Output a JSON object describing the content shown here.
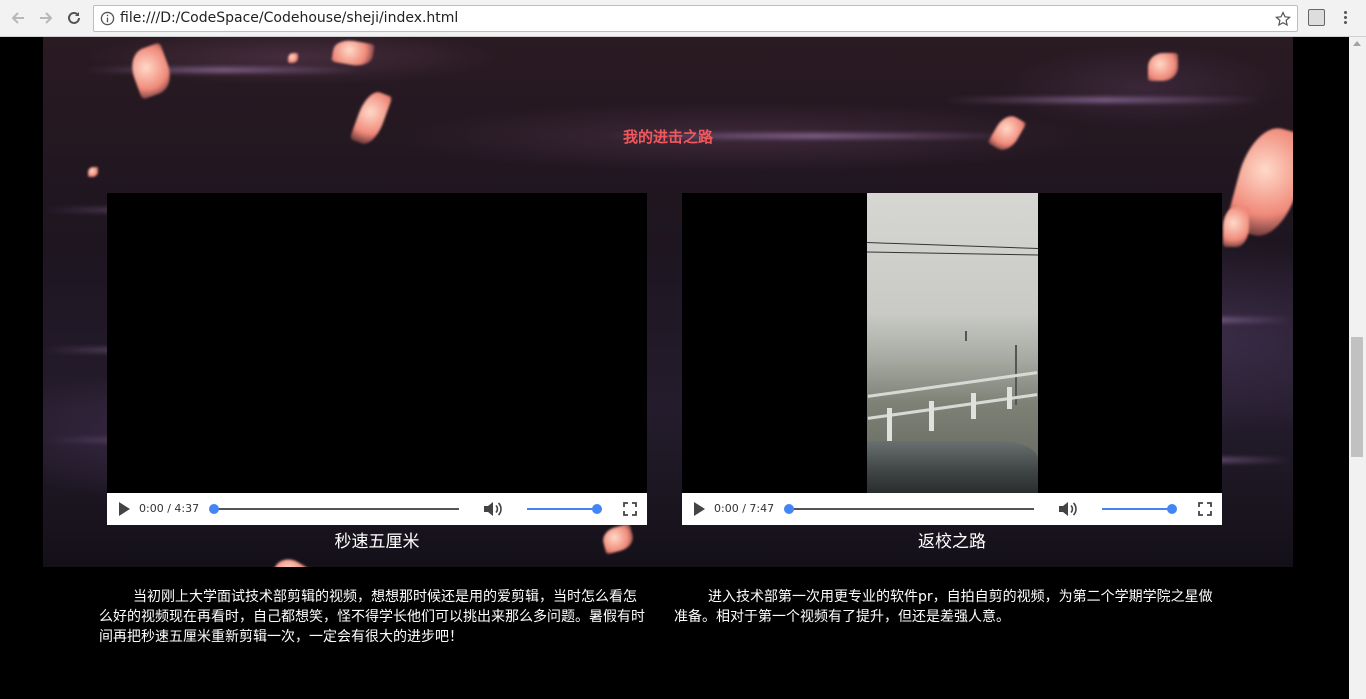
{
  "browser": {
    "url": "file:///D:/CodeSpace/Codehouse/sheji/index.html",
    "back_icon": "back-arrow-icon",
    "forward_icon": "forward-arrow-icon",
    "reload_icon": "reload-icon"
  },
  "section": {
    "title": "我的进击之路",
    "title_color": "#f2585b"
  },
  "videos": [
    {
      "time": "0:00 / 4:37",
      "caption": "秒速五厘米",
      "description": "当初刚上大学面试技术部剪辑的视频，想想那时候还是用的爱剪辑，当时怎么看怎么好的视频现在再看时，自己都想笑，怪不得学长他们可以挑出来那么多问题。暑假有时间再把秒速五厘米重新剪辑一次，一定会有很大的进步吧！"
    },
    {
      "time": "0:00 / 7:47",
      "caption": "返校之路",
      "description": "进入技术部第一次用更专业的软件pr，自拍自剪的视频，为第二个学期学院之星做准备。相对于第一个视频有了提升，但还是差强人意。"
    }
  ],
  "colors": {
    "accent": "#4285f4"
  }
}
